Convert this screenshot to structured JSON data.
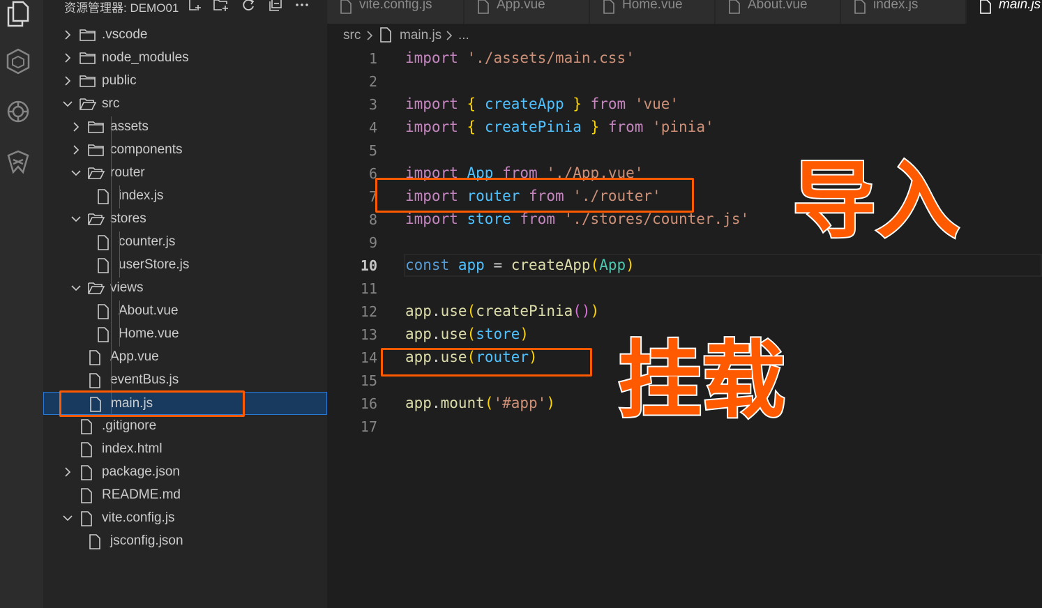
{
  "sidebar": {
    "title": "资源管理器: DEMO01",
    "actions": [
      "new-file-icon",
      "new-folder-icon",
      "refresh-icon",
      "collapse-icon",
      "more-icon"
    ],
    "tree": [
      {
        "label": ".vscode",
        "kind": "folder",
        "depth": 0,
        "expanded": false
      },
      {
        "label": "node_modules",
        "kind": "folder",
        "depth": 0,
        "expanded": false
      },
      {
        "label": "public",
        "kind": "folder",
        "depth": 0,
        "expanded": false
      },
      {
        "label": "src",
        "kind": "folder",
        "depth": 0,
        "expanded": true
      },
      {
        "label": "assets",
        "kind": "folder",
        "depth": 1,
        "expanded": false
      },
      {
        "label": "components",
        "kind": "folder",
        "depth": 1,
        "expanded": false
      },
      {
        "label": "router",
        "kind": "folder",
        "depth": 1,
        "expanded": true
      },
      {
        "label": "index.js",
        "kind": "file",
        "depth": 2
      },
      {
        "label": "stores",
        "kind": "folder",
        "depth": 1,
        "expanded": true
      },
      {
        "label": "counter.js",
        "kind": "file",
        "depth": 2
      },
      {
        "label": "userStore.js",
        "kind": "file",
        "depth": 2
      },
      {
        "label": "views",
        "kind": "folder",
        "depth": 1,
        "expanded": true
      },
      {
        "label": "About.vue",
        "kind": "file",
        "depth": 2
      },
      {
        "label": "Home.vue",
        "kind": "file",
        "depth": 2
      },
      {
        "label": "App.vue",
        "kind": "file",
        "depth": 1
      },
      {
        "label": "eventBus.js",
        "kind": "file",
        "depth": 1
      },
      {
        "label": "main.js",
        "kind": "file",
        "depth": 1,
        "selected": true
      },
      {
        "label": ".gitignore",
        "kind": "file",
        "depth": 0
      },
      {
        "label": "index.html",
        "kind": "file",
        "depth": 0
      },
      {
        "label": "package.json",
        "kind": "file",
        "depth": 0,
        "twisty": "collapsed"
      },
      {
        "label": "README.md",
        "kind": "file",
        "depth": 0
      },
      {
        "label": "vite.config.js",
        "kind": "file",
        "depth": 0,
        "twisty": "expanded"
      },
      {
        "label": "jsconfig.json",
        "kind": "file",
        "depth": 1
      }
    ]
  },
  "tabs": [
    {
      "label": "vite.config.js",
      "active": false
    },
    {
      "label": "App.vue",
      "active": false
    },
    {
      "label": "Home.vue",
      "active": false
    },
    {
      "label": "About.vue",
      "active": false
    },
    {
      "label": "index.js",
      "active": false
    },
    {
      "label": "main.js",
      "active": true
    }
  ],
  "breadcrumb": {
    "folder": "src",
    "file": "main.js",
    "more": "..."
  },
  "editor": {
    "current_line": 10,
    "line_numbers": [
      "1",
      "2",
      "3",
      "4",
      "5",
      "6",
      "7",
      "8",
      "9",
      "10",
      "11",
      "12",
      "13",
      "14",
      "15",
      "16",
      "17"
    ],
    "lines": [
      [
        [
          "kw",
          "import"
        ],
        [
          "op",
          " "
        ],
        [
          "str",
          "'./assets/main.css'"
        ]
      ],
      [],
      [
        [
          "kw",
          "import"
        ],
        [
          "op",
          " "
        ],
        [
          "br1",
          "{"
        ],
        [
          "op",
          " "
        ],
        [
          "var",
          "createApp"
        ],
        [
          "op",
          " "
        ],
        [
          "br1",
          "}"
        ],
        [
          "op",
          " "
        ],
        [
          "kw",
          "from"
        ],
        [
          "op",
          " "
        ],
        [
          "str",
          "'vue'"
        ]
      ],
      [
        [
          "kw",
          "import"
        ],
        [
          "op",
          " "
        ],
        [
          "br1",
          "{"
        ],
        [
          "op",
          " "
        ],
        [
          "var",
          "createPinia"
        ],
        [
          "op",
          " "
        ],
        [
          "br1",
          "}"
        ],
        [
          "op",
          " "
        ],
        [
          "kw",
          "from"
        ],
        [
          "op",
          " "
        ],
        [
          "str",
          "'pinia'"
        ]
      ],
      [],
      [
        [
          "kw",
          "import"
        ],
        [
          "op",
          " "
        ],
        [
          "var",
          "App"
        ],
        [
          "op",
          " "
        ],
        [
          "kw",
          "from"
        ],
        [
          "op",
          " "
        ],
        [
          "str",
          "'./App.vue'"
        ]
      ],
      [
        [
          "kw",
          "import"
        ],
        [
          "op",
          " "
        ],
        [
          "var",
          "router"
        ],
        [
          "op",
          " "
        ],
        [
          "kw",
          "from"
        ],
        [
          "op",
          " "
        ],
        [
          "str",
          "'./router'"
        ]
      ],
      [
        [
          "kw",
          "import"
        ],
        [
          "op",
          " "
        ],
        [
          "var",
          "store"
        ],
        [
          "op",
          " "
        ],
        [
          "kw",
          "from"
        ],
        [
          "op",
          " "
        ],
        [
          "str",
          "'./stores/counter.js'"
        ]
      ],
      [],
      [
        [
          "blue",
          "const"
        ],
        [
          "op",
          " "
        ],
        [
          "cst",
          "app"
        ],
        [
          "op",
          " = "
        ],
        [
          "fn",
          "createApp"
        ],
        [
          "br1",
          "("
        ],
        [
          "cls",
          "App"
        ],
        [
          "br1",
          ")"
        ]
      ],
      [],
      [
        [
          "fn",
          "app"
        ],
        [
          "op",
          "."
        ],
        [
          "fn",
          "use"
        ],
        [
          "br1",
          "("
        ],
        [
          "fn",
          "createPinia"
        ],
        [
          "br2",
          "()"
        ],
        [
          "br1",
          ")"
        ]
      ],
      [
        [
          "fn",
          "app"
        ],
        [
          "op",
          "."
        ],
        [
          "fn",
          "use"
        ],
        [
          "br1",
          "("
        ],
        [
          "var",
          "store"
        ],
        [
          "br1",
          ")"
        ]
      ],
      [
        [
          "fn",
          "app"
        ],
        [
          "op",
          "."
        ],
        [
          "fn",
          "use"
        ],
        [
          "br1",
          "("
        ],
        [
          "var",
          "router"
        ],
        [
          "br1",
          ")"
        ]
      ],
      [],
      [
        [
          "fn",
          "app"
        ],
        [
          "op",
          "."
        ],
        [
          "fn",
          "mount"
        ],
        [
          "br1",
          "("
        ],
        [
          "str",
          "'#app'"
        ],
        [
          "br1",
          ")"
        ]
      ],
      []
    ]
  },
  "annotations": {
    "import_label": "导入",
    "mount_label": "挂载",
    "highlight_color": "#ff5a00"
  },
  "activity_bar": [
    "explorer-icon",
    "extensions-icon",
    "chatgpt-icon",
    "copilot-icon"
  ]
}
